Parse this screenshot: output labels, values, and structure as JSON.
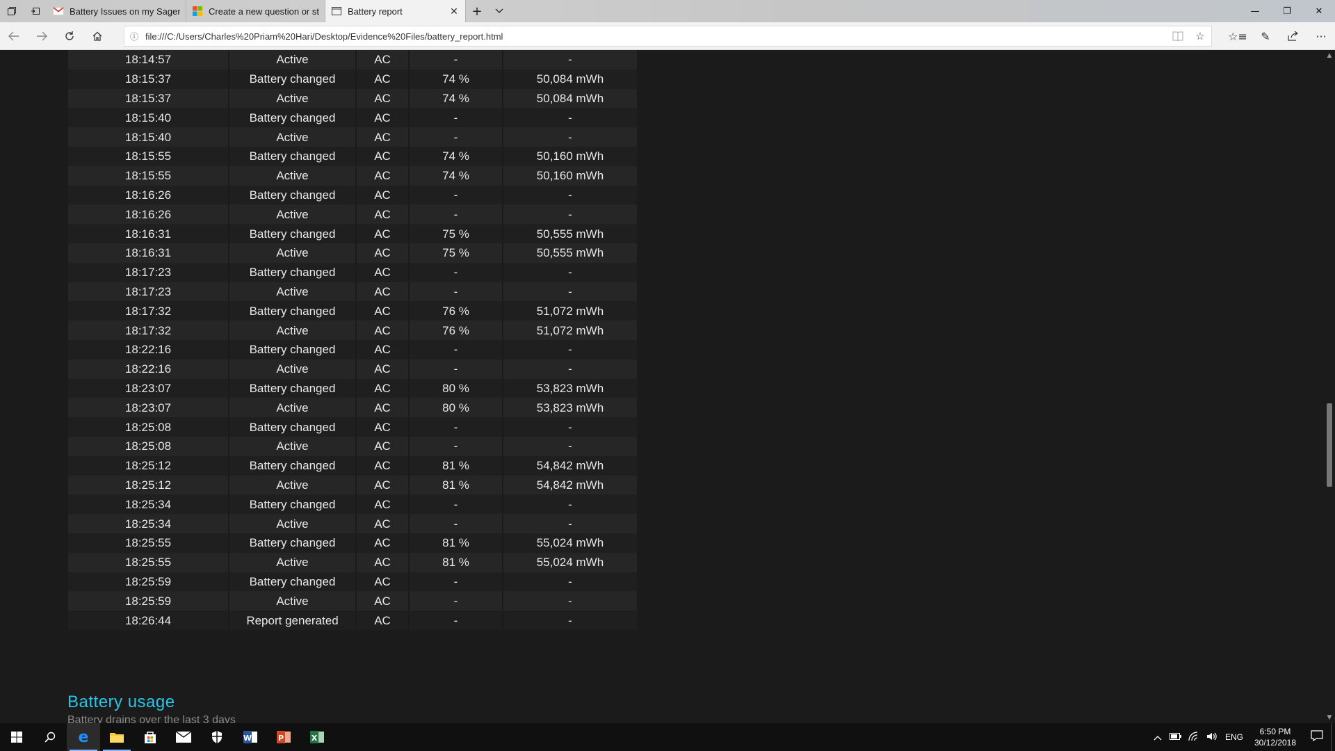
{
  "browser": {
    "tabs": [
      {
        "label": "Battery Issues on my Sager",
        "icon": "gmail-icon",
        "active": false
      },
      {
        "label": "Create a new question or st",
        "icon": "microsoft-icon",
        "active": false
      },
      {
        "label": "Battery report",
        "icon": "page-icon",
        "active": true
      }
    ],
    "url": "file:///C:/Users/Charles%20Priam%20Hari/Desktop/Evidence%20Files/battery_report.html"
  },
  "table": {
    "rows": [
      [
        "18:14:57",
        "Active",
        "AC",
        "-",
        "-"
      ],
      [
        "18:15:37",
        "Battery changed",
        "AC",
        "74 %",
        "50,084 mWh"
      ],
      [
        "18:15:37",
        "Active",
        "AC",
        "74 %",
        "50,084 mWh"
      ],
      [
        "18:15:40",
        "Battery changed",
        "AC",
        "-",
        "-"
      ],
      [
        "18:15:40",
        "Active",
        "AC",
        "-",
        "-"
      ],
      [
        "18:15:55",
        "Battery changed",
        "AC",
        "74 %",
        "50,160 mWh"
      ],
      [
        "18:15:55",
        "Active",
        "AC",
        "74 %",
        "50,160 mWh"
      ],
      [
        "18:16:26",
        "Battery changed",
        "AC",
        "-",
        "-"
      ],
      [
        "18:16:26",
        "Active",
        "AC",
        "-",
        "-"
      ],
      [
        "18:16:31",
        "Battery changed",
        "AC",
        "75 %",
        "50,555 mWh"
      ],
      [
        "18:16:31",
        "Active",
        "AC",
        "75 %",
        "50,555 mWh"
      ],
      [
        "18:17:23",
        "Battery changed",
        "AC",
        "-",
        "-"
      ],
      [
        "18:17:23",
        "Active",
        "AC",
        "-",
        "-"
      ],
      [
        "18:17:32",
        "Battery changed",
        "AC",
        "76 %",
        "51,072 mWh"
      ],
      [
        "18:17:32",
        "Active",
        "AC",
        "76 %",
        "51,072 mWh"
      ],
      [
        "18:22:16",
        "Battery changed",
        "AC",
        "-",
        "-"
      ],
      [
        "18:22:16",
        "Active",
        "AC",
        "-",
        "-"
      ],
      [
        "18:23:07",
        "Battery changed",
        "AC",
        "80 %",
        "53,823 mWh"
      ],
      [
        "18:23:07",
        "Active",
        "AC",
        "80 %",
        "53,823 mWh"
      ],
      [
        "18:25:08",
        "Battery changed",
        "AC",
        "-",
        "-"
      ],
      [
        "18:25:08",
        "Active",
        "AC",
        "-",
        "-"
      ],
      [
        "18:25:12",
        "Battery changed",
        "AC",
        "81 %",
        "54,842 mWh"
      ],
      [
        "18:25:12",
        "Active",
        "AC",
        "81 %",
        "54,842 mWh"
      ],
      [
        "18:25:34",
        "Battery changed",
        "AC",
        "-",
        "-"
      ],
      [
        "18:25:34",
        "Active",
        "AC",
        "-",
        "-"
      ],
      [
        "18:25:55",
        "Battery changed",
        "AC",
        "81 %",
        "55,024 mWh"
      ],
      [
        "18:25:55",
        "Active",
        "AC",
        "81 %",
        "55,024 mWh"
      ],
      [
        "18:25:59",
        "Battery changed",
        "AC",
        "-",
        "-"
      ],
      [
        "18:25:59",
        "Active",
        "AC",
        "-",
        "-"
      ],
      [
        "18:26:44",
        "Report generated",
        "AC",
        "-",
        "-"
      ]
    ]
  },
  "section": {
    "title": "Battery usage",
    "subtitle": "Battery drains over the last 3 days"
  },
  "taskbar": {
    "apps": [
      "start-icon",
      "search-icon",
      "edge-icon",
      "file-explorer-icon",
      "store-icon",
      "mail-icon",
      "security-icon",
      "word-icon",
      "powerpoint-icon",
      "excel-icon"
    ],
    "language": "ENG",
    "time": "6:50 PM",
    "date": "30/12/2018"
  },
  "colors": {
    "page_bg": "#1b1b1b",
    "row_odd": "#262626",
    "row_even": "#1f1f1f",
    "accent": "#25c6e8"
  }
}
